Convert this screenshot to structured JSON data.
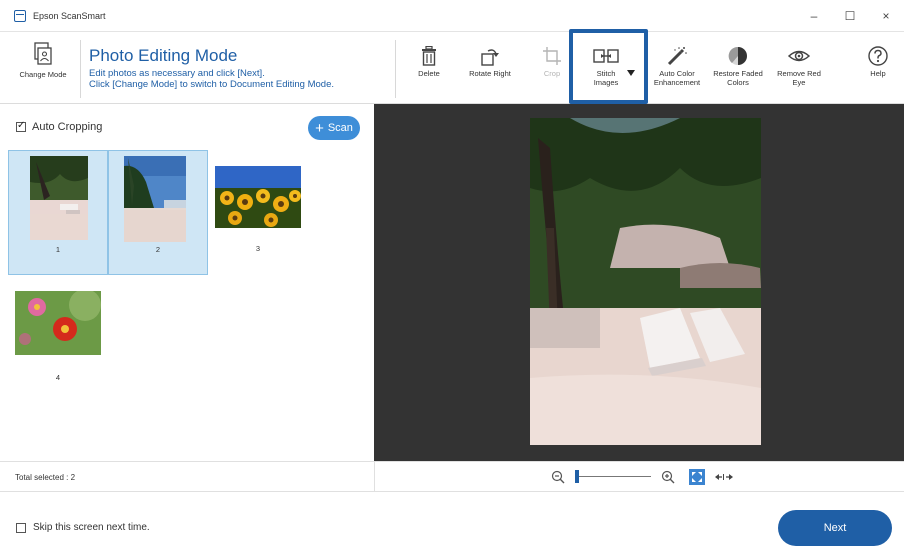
{
  "window": {
    "title": "Epson ScanSmart",
    "controls": {
      "minimize": "–",
      "maximize": "☐",
      "close": "×"
    }
  },
  "toolbar": {
    "change_mode": "Change Mode",
    "mode_title": "Photo Editing Mode",
    "mode_desc_line1": "Edit photos as necessary and click [Next].",
    "mode_desc_line2": "Click [Change Mode] to switch to Document Editing Mode.",
    "tools": {
      "delete": "Delete",
      "rotate": "Rotate Right",
      "crop": "Crop",
      "stitch_l1": "Stitch",
      "stitch_l2": "Images",
      "autocolor_l1": "Auto Color",
      "autocolor_l2": "Enhancement",
      "restore_l1": "Restore Faded",
      "restore_l2": "Colors",
      "redeye_l1": "Remove Red",
      "redeye_l2": "Eye",
      "help": "Help"
    }
  },
  "left": {
    "auto_cropping": "Auto Cropping",
    "auto_cropping_checked": true,
    "scan_label": "Scan",
    "thumbnails": [
      {
        "num": "1",
        "selected": true,
        "subject": "beach-chairs-icon"
      },
      {
        "num": "2",
        "selected": true,
        "subject": "beach-sky-icon"
      },
      {
        "num": "3",
        "selected": false,
        "subject": "sunflowers-icon"
      },
      {
        "num": "4",
        "selected": false,
        "subject": "flowers-icon"
      }
    ],
    "total_selected": "Total selected : 2"
  },
  "footer": {
    "skip_label": "Skip this screen next time.",
    "next_label": "Next"
  },
  "colors": {
    "accent": "#1f5fa6",
    "scan_button": "#3e8ed8",
    "selection": "#cfe6f5",
    "preview_bg": "#333333"
  }
}
